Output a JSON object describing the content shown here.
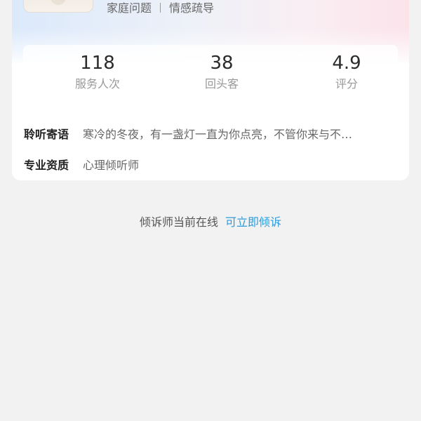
{
  "profile": {
    "tags": [
      "家庭问题",
      "情感疏导"
    ]
  },
  "stats": [
    {
      "value": "118",
      "label": "服务人次"
    },
    {
      "value": "38",
      "label": "回头客"
    },
    {
      "value": "4.9",
      "label": "评分"
    }
  ],
  "details": {
    "message_key": "聆听寄语",
    "message_value": "寒冷的冬夜，有一盏灯一直为你点亮，不管你来与不…",
    "qualification_key": "专业资质",
    "qualification_value": "心理倾听师"
  },
  "online": {
    "status_text": "倾诉师当前在线",
    "action_text": "可立即倾诉"
  },
  "colors": {
    "page_bg": "#f2f2f2",
    "card_bg": "#ffffff",
    "accent_link": "#2f9bd8"
  }
}
